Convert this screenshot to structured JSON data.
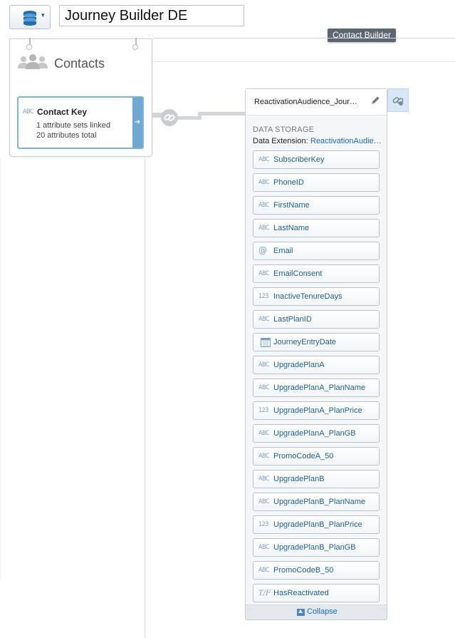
{
  "toolbar": {
    "data_source_icon": "database-stack-icon",
    "dropdown_icon": "caret-down-icon",
    "title_value": "Journey Builder DE"
  },
  "tooltip": {
    "text": "Contact Builder"
  },
  "contacts": {
    "title": "Contacts",
    "icon": "people-group-icon",
    "key_type": "ABC",
    "key_label": "Contact Key",
    "sets_linked": "1 attribute sets linked",
    "attributes_total": "20 attributes total"
  },
  "data_extension": {
    "name": "ReactivationAudience_JourneyEntry",
    "section": "DATA STORAGE",
    "ext_label": "Data Extension:",
    "ext_value": "ReactivationAudience_JourneyEntry",
    "fields": [
      {
        "type": "ABC",
        "name": "SubscriberKey"
      },
      {
        "type": "ABC",
        "name": "PhoneID"
      },
      {
        "type": "ABC",
        "name": "FirstName"
      },
      {
        "type": "ABC",
        "name": "LastName"
      },
      {
        "type": "@",
        "name": "Email"
      },
      {
        "type": "ABC",
        "name": "EmailConsent"
      },
      {
        "type": "123",
        "name": "InactiveTenureDays"
      },
      {
        "type": "ABC",
        "name": "LastPlanID"
      },
      {
        "type": "DATE",
        "name": "JourneyEntryDate"
      },
      {
        "type": "ABC",
        "name": "UpgradePlanA"
      },
      {
        "type": "ABC",
        "name": "UpgradePlanA_PlanName"
      },
      {
        "type": "123",
        "name": "UpgradePlanA_PlanPrice"
      },
      {
        "type": "ABC",
        "name": "UpgradePlanA_PlanGB"
      },
      {
        "type": "ABC",
        "name": "PromoCodeA_50"
      },
      {
        "type": "ABC",
        "name": "UpgradePlanB"
      },
      {
        "type": "ABC",
        "name": "UpgradePlanB_PlanName"
      },
      {
        "type": "123",
        "name": "UpgradePlanB_PlanPrice"
      },
      {
        "type": "ABC",
        "name": "UpgradePlanB_PlanGB"
      },
      {
        "type": "ABC",
        "name": "PromoCodeB_50"
      },
      {
        "type": "T/F",
        "name": "HasReactivated"
      }
    ],
    "collapse_label": "Collapse"
  },
  "colors": {
    "accent": "#1b6bb3",
    "key_border": "#7fb3d8",
    "link_panel": "#d7e7f5"
  }
}
